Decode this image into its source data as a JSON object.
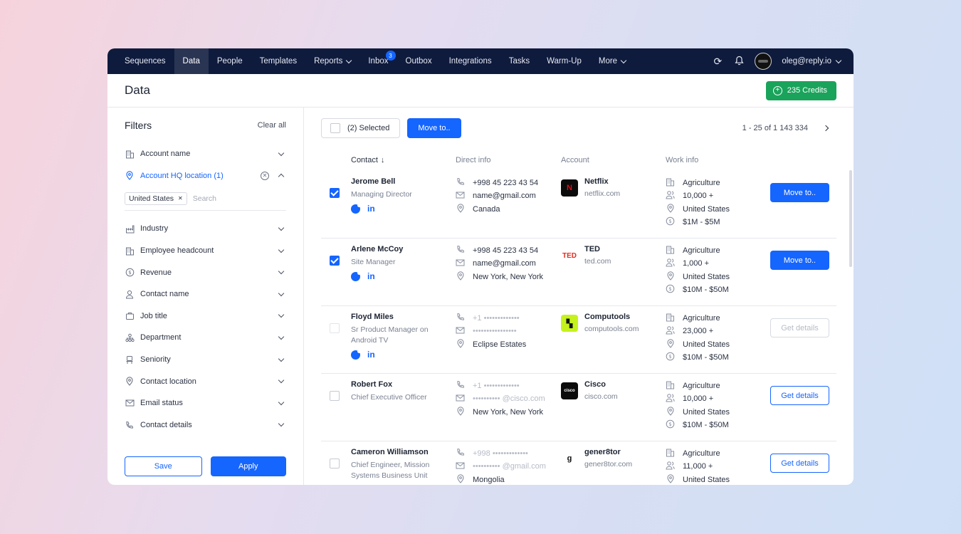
{
  "nav": {
    "items": [
      {
        "label": "Sequences"
      },
      {
        "label": "Data",
        "active": true
      },
      {
        "label": "People"
      },
      {
        "label": "Templates"
      },
      {
        "label": "Reports",
        "dropdown": true
      },
      {
        "label": "Inbox",
        "badge": "3"
      },
      {
        "label": "Outbox"
      },
      {
        "label": "Integrations"
      },
      {
        "label": "Tasks"
      },
      {
        "label": "Warm-Up"
      },
      {
        "label": "More",
        "dropdown": true
      }
    ],
    "user_email": "oleg@reply.io",
    "icons": [
      "refresh-icon",
      "bell-icon"
    ]
  },
  "header": {
    "title": "Data",
    "credits_label": "235 Credits"
  },
  "sidebar": {
    "title": "Filters",
    "clear_all": "Clear all",
    "filters": [
      {
        "label": "Account name",
        "icon": "building-icon"
      },
      {
        "label": "Account HQ location (1)",
        "icon": "location-pin-icon",
        "active": true
      },
      {
        "label": "Industry",
        "icon": "factory-icon"
      },
      {
        "label": "Employee headcount",
        "icon": "building-icon"
      },
      {
        "label": "Revenue",
        "icon": "dollar-icon"
      },
      {
        "label": "Contact name",
        "icon": "person-icon"
      },
      {
        "label": "Job title",
        "icon": "briefcase-icon"
      },
      {
        "label": "Department",
        "icon": "org-chart-icon"
      },
      {
        "label": "Seniority",
        "icon": "seat-icon"
      },
      {
        "label": "Contact location",
        "icon": "location-pin-icon"
      },
      {
        "label": "Email status",
        "icon": "mail-icon"
      },
      {
        "label": "Contact details",
        "icon": "phone-icon"
      }
    ],
    "location_tag": "United States",
    "search_placeholder": "Search",
    "save_label": "Save",
    "apply_label": "Apply"
  },
  "toolbar": {
    "selected_label": "(2) Selected",
    "move_label": "Move to..",
    "pagination": "1 - 25 of 1 143 334"
  },
  "table": {
    "headers": {
      "contact": "Contact",
      "direct": "Direct info",
      "account": "Account",
      "work": "Work info"
    },
    "rows": [
      {
        "checked": true,
        "name": "Jerome Bell",
        "role": "Managing Director",
        "socials": true,
        "phone": "+998 45 223 43 54",
        "email": "name@gmail.com",
        "location": "Canada",
        "direct_masked": false,
        "account": "Netflix",
        "domain": "netflix.com",
        "logo": "N",
        "logo_bg": "#0b0b0b",
        "logo_fg": "#e50914",
        "industry": "Agriculture",
        "headcount": "10,000 +",
        "country": "United States",
        "revenue": "$1M - $5M",
        "button": "Move to..",
        "button_style": "primary"
      },
      {
        "checked": true,
        "name": "Arlene McCoy",
        "role": "Site Manager",
        "socials": true,
        "phone": "+998 45 223 43 54",
        "email": "name@gmail.com",
        "location": "New York, New York",
        "direct_masked": false,
        "account": "TED",
        "domain": "ted.com",
        "logo": "TED",
        "logo_bg": "#ffffff",
        "logo_fg": "#e62b1e",
        "industry": "Agriculture",
        "headcount": "1,000 +",
        "country": "United States",
        "revenue": "$10M - $50M",
        "button": "Move to..",
        "button_style": "primary"
      },
      {
        "checked": false,
        "faded_cb": true,
        "name": "Floyd Miles",
        "role": "Sr Product Manager on Android TV",
        "socials": true,
        "phone": "+1 •••••••••••••",
        "email": "••••••••••••••••",
        "location": "Eclipse Estates",
        "direct_masked": true,
        "account": "Computools",
        "domain": "computools.com",
        "logo": "▚",
        "logo_bg": "#c6f21c",
        "logo_fg": "#111111",
        "industry": "Agriculture",
        "headcount": "23,000 +",
        "country": "United States",
        "revenue": "$10M - $50M",
        "button": "Get details",
        "button_style": "disabled"
      },
      {
        "checked": false,
        "name": "Robert Fox",
        "role": "Chief Executive Officer",
        "socials": false,
        "phone": "+1 •••••••••••••",
        "email": "•••••••••• @cisco.com",
        "location": "New York, New York",
        "direct_masked": true,
        "account": "Cisco",
        "domain": "cisco.com",
        "logo": "cisco",
        "logo_bg": "#0b0b0b",
        "logo_fg": "#ffffff",
        "industry": "Agriculture",
        "headcount": "10,000 +",
        "country": "United States",
        "revenue": "$10M - $50M",
        "button": "Get details",
        "button_style": "outline"
      },
      {
        "checked": false,
        "name": "Cameron Williamson",
        "role": "Chief Engineer, Mission Systems Business Unit",
        "socials": false,
        "phone": "+998 •••••••••••••",
        "email": "•••••••••• @gmail.com",
        "location": "Mongolia",
        "direct_masked": true,
        "account": "gener8tor",
        "domain": "gener8tor.com",
        "logo": "g",
        "logo_bg": "#ffffff",
        "logo_fg": "#111111",
        "industry": "Agriculture",
        "headcount": "11,000 +",
        "country": "United States",
        "revenue": "",
        "button": "Get details",
        "button_style": "outline"
      }
    ]
  }
}
